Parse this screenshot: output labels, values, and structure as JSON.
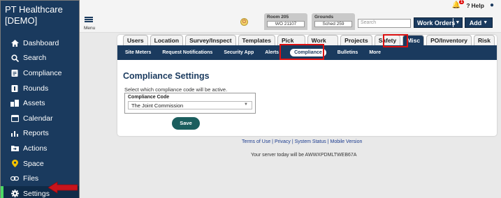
{
  "app": {
    "brand": "PT Healthcare [DEMO]"
  },
  "sidebar": {
    "items": [
      {
        "label": "Dashboard",
        "icon": "home-icon"
      },
      {
        "label": "Search",
        "icon": "search-icon"
      },
      {
        "label": "Compliance",
        "icon": "clipboard-icon"
      },
      {
        "label": "Rounds",
        "icon": "rounds-icon"
      },
      {
        "label": "Assets",
        "icon": "assets-icon"
      },
      {
        "label": "Calendar",
        "icon": "calendar-icon"
      },
      {
        "label": "Reports",
        "icon": "bar-chart-icon"
      },
      {
        "label": "Actions",
        "icon": "actions-icon"
      },
      {
        "label": "Space",
        "icon": "map-pin-icon"
      },
      {
        "label": "Files",
        "icon": "link-icon"
      },
      {
        "label": "Settings",
        "icon": "gear-icon"
      }
    ],
    "active_accent": "#4cd964"
  },
  "topbar": {
    "menu_label": "Menu",
    "notification_count": "1",
    "help_label": "Help",
    "room": {
      "title": "Room 205",
      "value": "WO 21107"
    },
    "grounds": {
      "title": "Grounds",
      "value": "Sched 259"
    },
    "search_placeholder": "Search",
    "work_orders_label": "Work Orders",
    "add_label": "Add"
  },
  "tabs": [
    {
      "label": "Users",
      "active": false
    },
    {
      "label": "Location",
      "active": false
    },
    {
      "label": "Survey/Inspect",
      "active": false
    },
    {
      "label": "Templates",
      "active": false
    },
    {
      "label": "Pick Lists",
      "active": false
    },
    {
      "label": "Work Order",
      "active": false
    },
    {
      "label": "Projects",
      "active": false
    },
    {
      "label": "Safety",
      "active": false
    },
    {
      "label": "Misc",
      "active": true
    },
    {
      "label": "PO/Inventory",
      "active": false
    },
    {
      "label": "Risk",
      "active": false
    }
  ],
  "subnav": [
    {
      "label": "Site Meters",
      "active": false
    },
    {
      "label": "Request Notifications",
      "active": false
    },
    {
      "label": "Security App",
      "active": false
    },
    {
      "label": "Alerts",
      "active": false
    },
    {
      "label": "Compliance",
      "active": true
    },
    {
      "label": "Bulletins",
      "active": false
    },
    {
      "label": "More",
      "active": false
    }
  ],
  "main": {
    "heading": "Compliance Settings",
    "hint": "Select which compliance code will be active.",
    "code_label": "Compliance Code",
    "code_value": "The Joint Commission",
    "save_label": "Save"
  },
  "footer": {
    "links": [
      "Terms of Use",
      "Privacy",
      "System Status",
      "Mobile Version"
    ],
    "separator": " | ",
    "server_text": "Your server today will be AWWXPDMLTWEB67A"
  },
  "colors": {
    "navy": "#1a3a5e",
    "highlight": "#dd1111",
    "save": "#1b5e5e"
  }
}
